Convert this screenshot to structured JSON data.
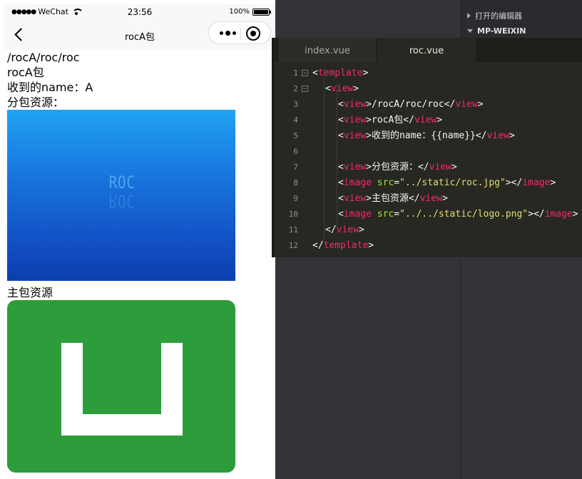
{
  "status_bar": {
    "carrier": "WeChat",
    "time": "23:56",
    "battery": "100%"
  },
  "navbar": {
    "title": "rocA包"
  },
  "page": {
    "line1": "/rocA/roc/roc",
    "line2": "rocA包",
    "line3": "收到的name：A",
    "line4": "分包资源：",
    "roc_image_text": "ROC",
    "line5": "主包资源"
  },
  "editor": {
    "tabs": [
      {
        "label": "index.vue",
        "active": false
      },
      {
        "label": "roc.vue",
        "active": true
      }
    ],
    "lines": [
      {
        "n": "1",
        "parts": [
          [
            "t",
            "<"
          ],
          [
            "g",
            "template"
          ],
          [
            "t",
            ">"
          ]
        ]
      },
      {
        "n": "2",
        "parts": [
          [
            "t",
            "<"
          ],
          [
            "g",
            "view"
          ],
          [
            "t",
            ">"
          ]
        ]
      },
      {
        "n": "3",
        "parts": [
          [
            "t",
            "<"
          ],
          [
            "g",
            "view"
          ],
          [
            "t",
            ">/rocA/roc/roc</"
          ],
          [
            "g",
            "view"
          ],
          [
            "t",
            ">"
          ]
        ]
      },
      {
        "n": "4",
        "parts": [
          [
            "t",
            "<"
          ],
          [
            "g",
            "view"
          ],
          [
            "t",
            ">rocA包</"
          ],
          [
            "g",
            "view"
          ],
          [
            "t",
            ">"
          ]
        ]
      },
      {
        "n": "5",
        "parts": [
          [
            "t",
            "<"
          ],
          [
            "g",
            "view"
          ],
          [
            "t",
            ">收到的name：{{name}}</"
          ],
          [
            "g",
            "view"
          ],
          [
            "t",
            ">"
          ]
        ]
      },
      {
        "n": "6",
        "parts": []
      },
      {
        "n": "7",
        "parts": [
          [
            "t",
            "<"
          ],
          [
            "g",
            "view"
          ],
          [
            "t",
            ">分包资源：</"
          ],
          [
            "g",
            "view"
          ],
          [
            "t",
            ">"
          ]
        ]
      },
      {
        "n": "8",
        "parts": [
          [
            "t",
            "<"
          ],
          [
            "g",
            "image"
          ],
          [
            "t",
            " "
          ],
          [
            "a",
            "src"
          ],
          [
            "t",
            "="
          ],
          [
            "s",
            "\"../static/roc.jpg\""
          ],
          [
            "t",
            "></"
          ],
          [
            "g",
            "image"
          ],
          [
            "t",
            ">"
          ]
        ]
      },
      {
        "n": "9",
        "parts": [
          [
            "t",
            "<"
          ],
          [
            "g",
            "view"
          ],
          [
            "t",
            ">主包资源</"
          ],
          [
            "g",
            "view"
          ],
          [
            "t",
            ">"
          ]
        ]
      },
      {
        "n": "10",
        "parts": [
          [
            "t",
            "<"
          ],
          [
            "g",
            "image"
          ],
          [
            "t",
            " "
          ],
          [
            "a",
            "src"
          ],
          [
            "t",
            "="
          ],
          [
            "s",
            "\"../../static/logo.png\""
          ],
          [
            "t",
            "></"
          ],
          [
            "g",
            "image"
          ],
          [
            "t",
            ">"
          ]
        ]
      },
      {
        "n": "11",
        "parts": [
          [
            "t",
            "</"
          ],
          [
            "g",
            "view"
          ],
          [
            "t",
            ">"
          ]
        ]
      },
      {
        "n": "12",
        "parts": [
          [
            "t",
            "</"
          ],
          [
            "g",
            "template"
          ],
          [
            "t",
            ">"
          ]
        ]
      }
    ]
  },
  "sidebar": {
    "open_editors": "打开的编辑器",
    "project": "MP-WEIXIN"
  },
  "colors": {
    "tag": "#f92672",
    "attr": "#a6e22e",
    "string": "#e6db74",
    "editor_bg": "#272822",
    "logo_green": "#2d9d3c"
  }
}
